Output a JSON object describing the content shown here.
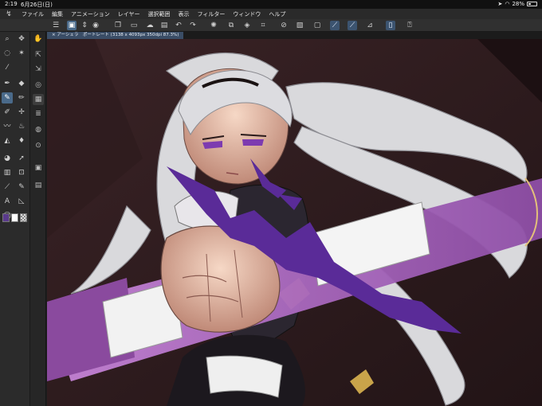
{
  "status": {
    "time": "2:19",
    "date": "6月26日(日)",
    "battery": "28%"
  },
  "menu": {
    "items": [
      "ファイル",
      "編集",
      "アニメーション",
      "レイヤー",
      "選択範囲",
      "表示",
      "フィルター",
      "ウィンドウ",
      "ヘルプ"
    ]
  },
  "canvas": {
    "tab_close": "×",
    "tab_title": "アーシェラ　ポートレート (3138 x 4093px 350dpi 87.3%)"
  },
  "icons": {
    "app_logo": "clip-studio-logo-icon",
    "tools": [
      "zoom-icon",
      "move-icon",
      "lasso-icon",
      "magic-wand-icon",
      "eyedropper-icon",
      "pen-icon",
      "pencil-icon",
      "brush-icon",
      "airbrush-icon",
      "eraser-icon",
      "fill-icon",
      "gradient-icon",
      "figure-icon",
      "text-icon",
      "balloon-icon"
    ]
  },
  "colors": {
    "main_color": "#5a3a8c",
    "sub_color": "#ffffff",
    "active_tool": "#4a6a8a",
    "canvas_bg": "#2a1a1c"
  }
}
